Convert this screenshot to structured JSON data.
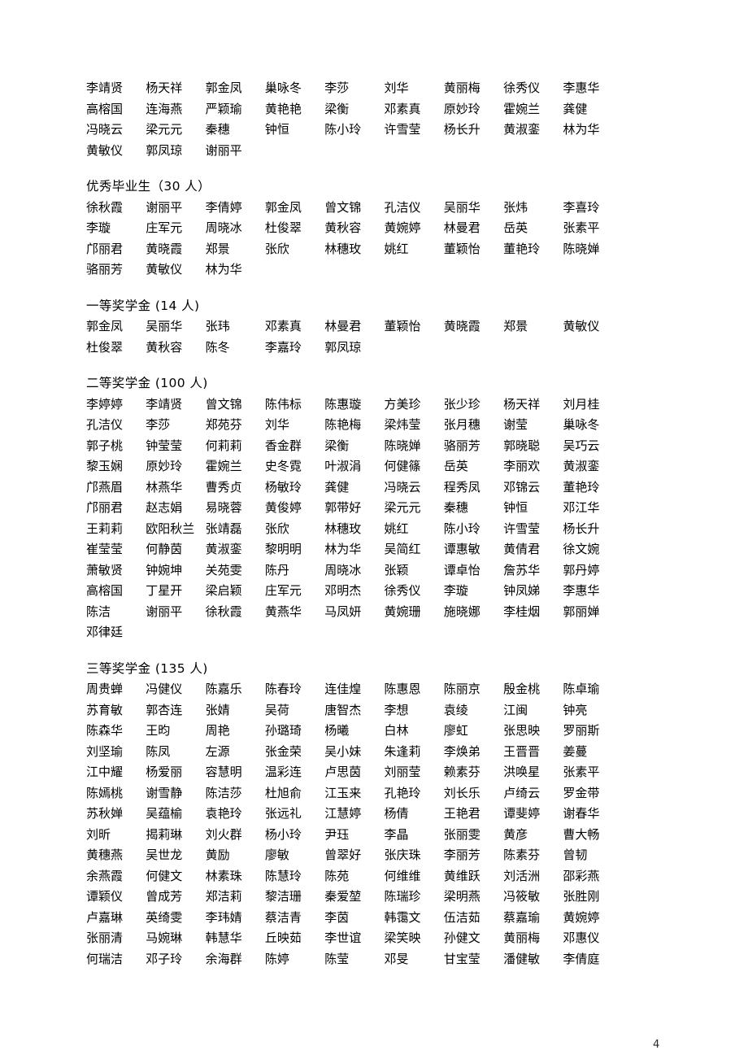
{
  "document": {
    "page_number": "4",
    "columns_per_row": 9
  },
  "sections": [
    {
      "id": "continued-list",
      "title": null,
      "rows": [
        [
          "李靖贤",
          "杨天祥",
          "郭金凤",
          "巢咏冬",
          "李 莎",
          "刘 华",
          "黄丽梅",
          "徐秀仪",
          "李惠华"
        ],
        [
          "高榕国",
          "连海燕",
          "严颖瑜",
          "黄艳艳",
          "梁 衡",
          "邓素真",
          "原妙玲",
          "霍婉兰",
          "龚 健"
        ],
        [
          "冯晓云",
          "梁元元",
          "秦 穗",
          "钟 恒",
          "陈小玲",
          "许雪莹",
          "杨长升",
          "黄淑銮",
          "林为华"
        ],
        [
          "黄敏仪",
          "郭凤琼",
          "谢丽平"
        ]
      ]
    },
    {
      "id": "outstanding-graduates",
      "title": "优秀毕业生（30 人）",
      "title_main": "优秀毕业生",
      "title_count": "（30 人）",
      "rows": [
        [
          "徐秋霞",
          "谢丽平",
          "李倩婷",
          "郭金凤",
          "曾文锦",
          "孔洁仪",
          "吴丽华",
          "张 炜",
          "李喜玲"
        ],
        [
          "李 璇",
          "庄军元",
          "周晓冰",
          "杜俊翠",
          "黄秋容",
          "黄婉婷",
          "林曼君",
          "岳 英",
          "张素平"
        ],
        [
          "邝丽君",
          "黄晓霞",
          "郑 景",
          "张 欣",
          "林穗玫",
          "姚 红",
          "董颖怡",
          "董艳玲",
          "陈晓婵"
        ],
        [
          "骆丽芳",
          "黄敏仪",
          "林为华"
        ]
      ]
    },
    {
      "id": "first-prize-scholarship",
      "title": "一等奖学金 (14 人)",
      "title_main": "一等奖学金",
      "title_count": " (14 人)",
      "rows": [
        [
          "郭金凤",
          "吴丽华",
          "张 玮",
          "邓素真",
          "林曼君",
          "董颖怡",
          "黄晓霞",
          "郑 景",
          "黄敏仪"
        ],
        [
          "杜俊翠",
          "黄秋容",
          "陈 冬",
          "李嘉玲",
          "郭凤琼"
        ]
      ]
    },
    {
      "id": "second-prize-scholarship",
      "title": "二等奖学金 (100 人)",
      "title_main": "二等奖学金",
      "title_count": " (100 人)",
      "rows": [
        [
          "李婷婷",
          "李靖贤",
          "曾文锦",
          "陈伟标",
          "陈惠璇",
          "方美珍",
          "张少珍",
          "杨天祥",
          "刘月桂"
        ],
        [
          "孔洁仪",
          "李 莎",
          "郑苑芬",
          "刘 华",
          "陈艳梅",
          "梁炜莹",
          "张月穗",
          "谢 莹",
          "巢咏冬"
        ],
        [
          "郭子桃",
          "钟莹莹",
          "何莉莉",
          "香金群",
          "梁 衡",
          "陈晓婵",
          "骆丽芳",
          "郭晓聪",
          "吴巧云"
        ],
        [
          "黎玉娴",
          "原妙玲",
          "霍婉兰",
          "史冬霓",
          "叶淑涓",
          "何健篠",
          "岳 英",
          "李丽欢",
          "黄淑銮"
        ],
        [
          "邝燕眉",
          "林燕华",
          "曹秀贞",
          "杨敏玲",
          "龚 健",
          "冯晓云",
          "程秀凤",
          "邓锦云",
          "董艳玲"
        ],
        [
          "邝丽君",
          "赵志娟",
          "易晓蓉",
          "黄俊婷",
          "郭带好",
          "梁元元",
          "秦 穗",
          "钟 恒",
          "邓江华"
        ],
        [
          "王莉莉",
          "欧阳秋兰",
          "张靖磊",
          "张 欣",
          "林穗玫",
          "姚 红",
          "陈小玲",
          "许雪莹",
          "杨长升"
        ],
        [
          "崔莹莹",
          "何静茵",
          "黄淑銮",
          "黎明明",
          "林为华",
          "吴简红",
          "谭惠敏",
          "黄倩君",
          "徐文婉"
        ],
        [
          "萧敏贤",
          "钟婉坤",
          "关苑雯",
          "陈 丹",
          "周晓冰",
          "张 颖",
          "谭卓怡",
          "詹苏华",
          "郭丹婷"
        ],
        [
          "高榕国",
          "丁星开",
          "梁启颖",
          "庄军元",
          "邓明杰",
          "徐秀仪",
          "李 璇",
          "钟凤娣",
          "李惠华"
        ],
        [
          "陈 洁",
          "谢丽平",
          "徐秋霞",
          "黄燕华",
          "马凤妍",
          "黄婉珊",
          "施晓娜",
          "李桂烟",
          "郭丽婵"
        ],
        [
          "邓律廷"
        ]
      ]
    },
    {
      "id": "third-prize-scholarship",
      "title": "三等奖学金 (135 人)",
      "title_main": "三等奖学金",
      "title_count": " (135 人)",
      "rows": [
        [
          "周贵蝉",
          "冯健仪",
          "陈嘉乐",
          "陈春玲",
          "连佳煌",
          "陈惠恩",
          "陈丽京",
          "殷金桃",
          "陈卓瑜"
        ],
        [
          "苏育敏",
          "郭杏连",
          "张 婧",
          "吴 荷",
          "唐智杰",
          "李 想",
          "袁 绫",
          "江 闽",
          "钟 亮"
        ],
        [
          "陈森华",
          "王 昀",
          "周 艳",
          "孙璐琦",
          "杨 曦",
          "白 林",
          "廖 虹",
          "张思映",
          "罗丽斯"
        ],
        [
          "刘坚瑜",
          "陈 凤",
          "左 源",
          "张金荣",
          "吴小妹",
          "朱逢莉",
          "李焕弟",
          "王晋晋",
          "姜 蔓"
        ],
        [
          "江中耀",
          "杨爱丽",
          "容慧明",
          "温彩连",
          "卢思茵",
          "刘丽莹",
          "赖素芬",
          "洪唤星",
          "张素平"
        ],
        [
          "陈嫣桃",
          "谢雪静",
          "陈洁莎",
          "杜旭俞",
          "江玉来",
          "孔艳玲",
          "刘长乐",
          "卢绮云",
          "罗金带"
        ],
        [
          "苏秋婵",
          "吴蕴榆",
          "袁艳玲",
          "张远礼",
          "江慧婷",
          "杨 倩",
          "王艳君",
          "谭斐婷",
          "谢春华"
        ],
        [
          "刘 昕",
          "揭莉琳",
          "刘火群",
          "杨小玲",
          "尹 珏",
          "李 晶",
          "张丽雯",
          "黄 彦",
          "曹大畅"
        ],
        [
          "黄穗燕",
          "吴世龙",
          "黄 励",
          "廖 敏",
          "曾翠好",
          "张庆珠",
          "李丽芳",
          "陈素芬",
          "曾 韧"
        ],
        [
          "余燕霞",
          "何健文",
          "林素珠",
          "陈慧玲",
          "陈 苑",
          "何维维",
          "黄维跃",
          "刘活洲",
          "邵彩燕"
        ],
        [
          "谭颖仪",
          "曾成芳",
          "郑洁莉",
          "黎洁珊",
          "秦爱堃",
          "陈瑞珍",
          "梁明燕",
          "冯筱敏",
          "张胜刚"
        ],
        [
          "卢嘉琳",
          "英绮雯",
          "李玮婧",
          "蔡洁青",
          "李 茵",
          "韩霭文",
          "伍洁茹",
          "蔡嘉瑜",
          "黄婉婷"
        ],
        [
          "张丽清",
          "马婉琳",
          "韩慧华",
          "丘映茹",
          "李世谊",
          "梁笑映",
          "孙健文",
          "黄丽梅",
          "邓惠仪"
        ],
        [
          "何瑞洁",
          "邓子玲",
          "余海群",
          "陈 婷",
          "陈 莹",
          "邓 旻",
          "甘宝莹",
          "潘健敏",
          "李倩庭"
        ]
      ]
    }
  ]
}
